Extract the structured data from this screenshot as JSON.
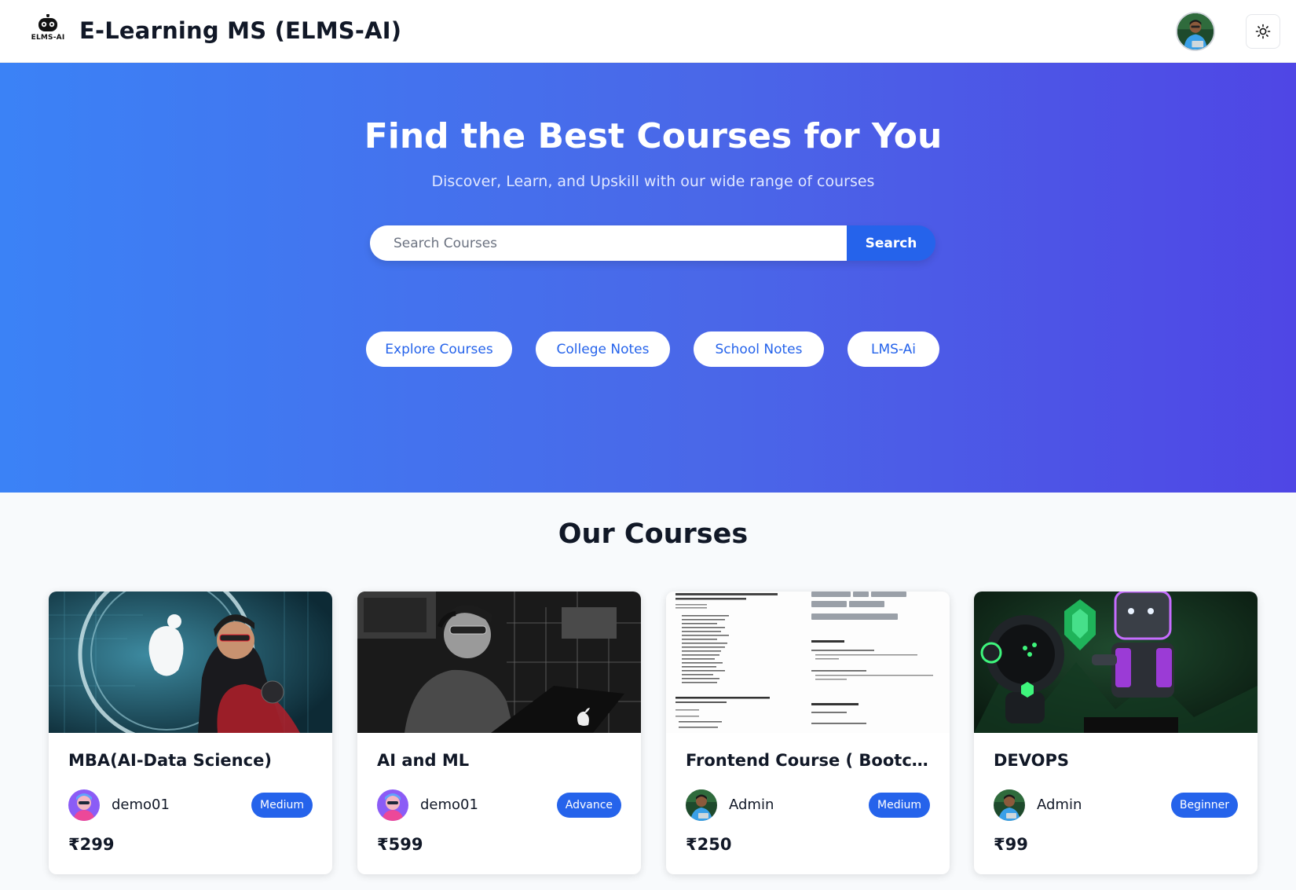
{
  "header": {
    "logo_text": "ELMS-AI",
    "title": "E-Learning MS (ELMS-AI)",
    "avatar_icon": "user-avatar",
    "theme_icon": "sun-icon"
  },
  "hero": {
    "title": "Find the Best Courses for You",
    "subtitle": "Discover, Learn, and Upskill with our wide range of courses",
    "search": {
      "placeholder": "Search Courses",
      "value": "",
      "button_label": "Search"
    },
    "links": [
      {
        "label": "Explore Courses"
      },
      {
        "label": "College Notes"
      },
      {
        "label": "School Notes"
      },
      {
        "label": "LMS-Ai"
      }
    ]
  },
  "courses": {
    "heading": "Our Courses",
    "items": [
      {
        "title": "MBA(AI-Data Science)",
        "author": "demo01",
        "level": "Medium",
        "price": "₹299"
      },
      {
        "title": "AI and ML",
        "author": "demo01",
        "level": "Advance",
        "price": "₹599"
      },
      {
        "title": "Frontend Course ( Bootcam...",
        "author": "Admin",
        "level": "Medium",
        "price": "₹250"
      },
      {
        "title": "DEVOPS",
        "author": "Admin",
        "level": "Beginner",
        "price": "₹99"
      }
    ]
  },
  "colors": {
    "accent": "#2563eb",
    "hero_start": "#3b82f6",
    "hero_end": "#4f46e5"
  }
}
